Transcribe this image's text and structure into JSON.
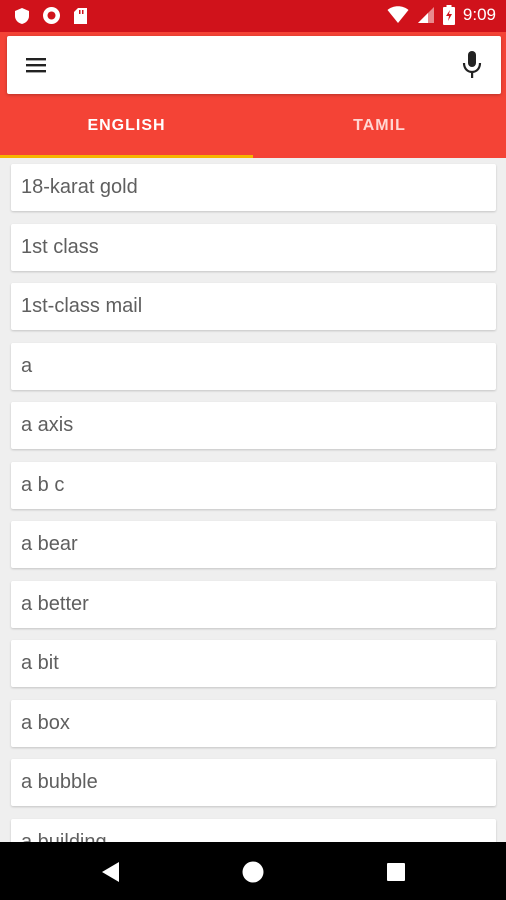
{
  "status_bar": {
    "time": "9:09",
    "icons": [
      "shield-icon",
      "record-icon",
      "sd-card-icon",
      "wifi-icon",
      "signal-icon",
      "battery-icon"
    ]
  },
  "search": {
    "placeholder": "",
    "value": "",
    "menu_icon": "menu-icon",
    "mic_icon": "mic-icon"
  },
  "tabs": [
    {
      "label": "ENGLISH",
      "selected": true
    },
    {
      "label": "TAMIL",
      "selected": false
    }
  ],
  "words": [
    "18-karat gold",
    "1st class",
    "1st-class mail",
    "a",
    "a axis",
    "a b c",
    "a bear",
    "a better",
    "a bit",
    "a box",
    "a bubble",
    "a building"
  ],
  "nav": [
    "back-icon",
    "home-icon",
    "recents-icon"
  ],
  "colors": {
    "status_bar": "#d0121b",
    "primary": "#f44336",
    "tab_indicator": "#f6b400",
    "background": "#efefef"
  }
}
